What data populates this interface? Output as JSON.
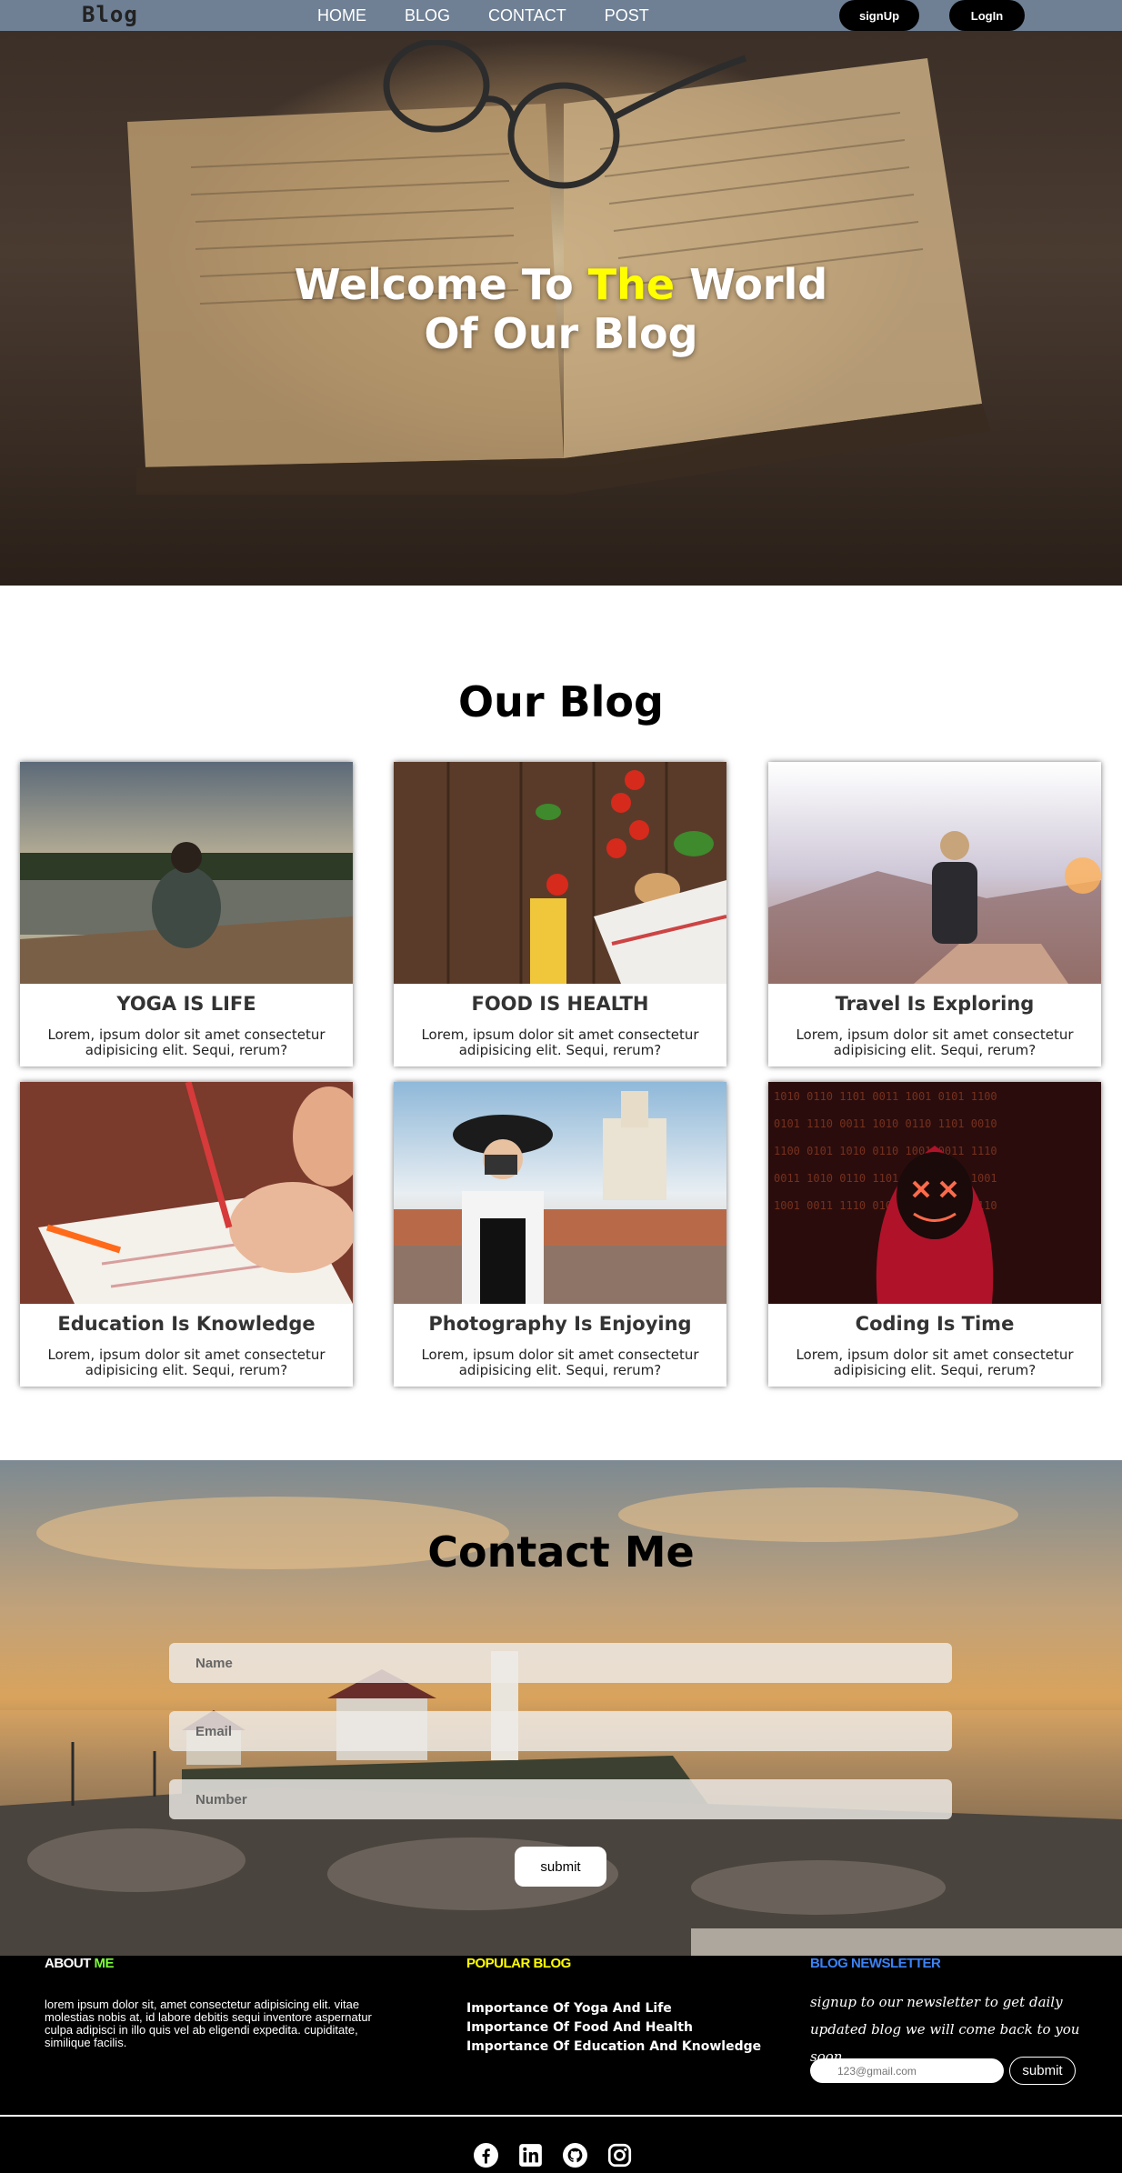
{
  "nav": {
    "brand": "Blog",
    "links": [
      "HOME",
      "BLOG",
      "CONTACT",
      "POST"
    ],
    "signup_label": "signUp",
    "login_label": "LogIn"
  },
  "hero": {
    "title_part1": "Welcome To ",
    "title_highlight": "The",
    "title_part2": " World",
    "title_line2": "Of Our Blog"
  },
  "blog": {
    "heading": "Our Blog",
    "cards": [
      {
        "title": "YOGA IS LIFE",
        "text": "Lorem, ipsum dolor sit amet consectetur adipisicing elit. Sequi, rerum?"
      },
      {
        "title": "FOOD IS HEALTH",
        "text": "Lorem, ipsum dolor sit amet consectetur adipisicing elit. Sequi, rerum?"
      },
      {
        "title": "Travel Is Exploring",
        "text": "Lorem, ipsum dolor sit amet consectetur adipisicing elit. Sequi, rerum?"
      },
      {
        "title": "Education Is Knowledge",
        "text": "Lorem, ipsum dolor sit amet consectetur adipisicing elit. Sequi, rerum?"
      },
      {
        "title": "Photography Is Enjoying",
        "text": "Lorem, ipsum dolor sit amet consectetur adipisicing elit. Sequi, rerum?"
      },
      {
        "title": "Coding Is Time",
        "text": "Lorem, ipsum dolor sit amet consectetur adipisicing elit. Sequi, rerum?"
      }
    ]
  },
  "contact": {
    "heading": "Contact Me",
    "name_placeholder": "Name",
    "email_placeholder": "Email",
    "number_placeholder": "Number",
    "submit_label": "submit"
  },
  "footer": {
    "about_head_1": "ABOUT ",
    "about_head_2": "ME",
    "about_text": "lorem ipsum dolor sit, amet consectetur adipisicing elit. vitae molestias nobis at, id labore debitis sequi inventore aspernatur culpa adipisci in illo quis vel ab eligendi expedita. cupiditate, similique facilis.",
    "popular_head": "POPULAR BLOG",
    "popular_links": [
      "Importance Of Yoga And Life",
      "Importance Of Food And Health",
      "Importance Of Education And Knowledge"
    ],
    "news_head": "BLOG NEWSLETTER",
    "news_text": "signup to our newsletter to get daily updated blog we will come back to you soon",
    "news_placeholder": "123@gmail.com",
    "news_submit": "submit",
    "social_icons": [
      "facebook-icon",
      "linkedin-icon",
      "github-icon",
      "instagram-icon"
    ]
  }
}
